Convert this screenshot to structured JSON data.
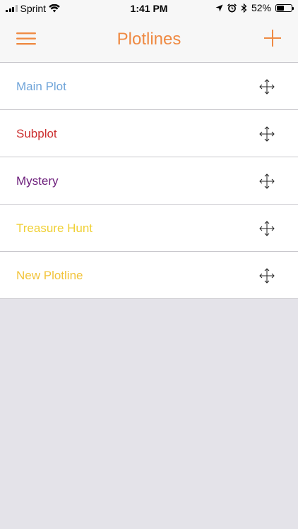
{
  "status_bar": {
    "carrier": "Sprint",
    "time": "1:41 PM",
    "battery_percent": "52%",
    "battery_level": 0.52
  },
  "nav": {
    "title": "Plotlines",
    "title_color": "#ef8a43"
  },
  "plotlines": [
    {
      "label": "Main Plot",
      "color": "#6fa4d9"
    },
    {
      "label": "Subplot",
      "color": "#cc2f2f"
    },
    {
      "label": "Mystery",
      "color": "#6b1c7a"
    },
    {
      "label": "Treasure Hunt",
      "color": "#f0d035"
    },
    {
      "label": "New Plotline",
      "color": "#f2c43c"
    }
  ],
  "icons": {
    "menu": "hamburger-menu-icon",
    "add": "plus-icon",
    "drag": "move-arrows-icon",
    "wifi": "wifi-icon",
    "location": "location-arrow-icon",
    "alarm": "alarm-clock-icon",
    "bluetooth": "bluetooth-icon",
    "battery": "battery-icon"
  }
}
